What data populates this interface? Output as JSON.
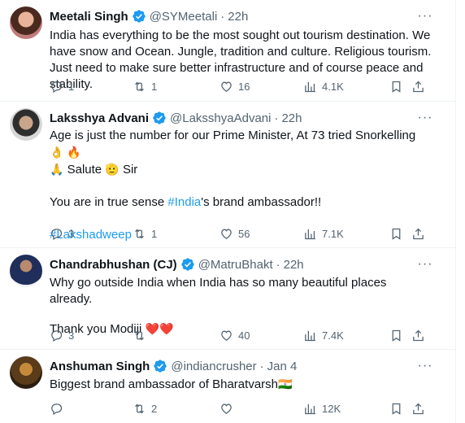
{
  "tweets": [
    {
      "name": "Meetali Singh",
      "handle": "@SYMeetali",
      "time": "22h",
      "text": "India has everything to be the most sought out tourism destination. We have snow and Ocean. Jungle, tradition and culture. Religious tourism. Just need to make sure better infrastructure and of course peace and stability.",
      "replies": "1",
      "retweets": "1",
      "likes": "16",
      "views": "4.1K"
    },
    {
      "name": "Laksshya Advani",
      "handle": "@LaksshyaAdvani",
      "time": "22h",
      "line1": "Age is just the number for our Prime Minister, At 73 tried Snorkelling",
      "line1_emoji": "👌 🔥",
      "line2_emoji_a": "🙏",
      "line2_text_a": "Salute",
      "line2_emoji_b": "🫡",
      "line2_text_b": "Sir",
      "para2_pre": "You are in true sense ",
      "para2_hashtag": "#India",
      "para2_post": "'s brand ambassador!!",
      "hashtag": "#Lakshadweep",
      "replies": "3",
      "retweets": "1",
      "likes": "56",
      "views": "7.1K"
    },
    {
      "name": "Chandrabhushan (CJ)",
      "handle": "@MatruBhakt",
      "time": "22h",
      "line1": "Why go outside India when India has so many beautiful places already.",
      "line2": "Thank you Modiji",
      "line2_emoji": "❤️❤️",
      "replies": "3",
      "retweets": "",
      "likes": "40",
      "views": "7.4K"
    },
    {
      "name": "Anshuman Singh",
      "handle": "@indiancrusher",
      "time": "Jan 4",
      "line1": "Biggest brand ambassador of Bharatvarsh",
      "line1_emoji": "🇮🇳",
      "replies": "",
      "retweets": "2",
      "likes": "",
      "views": "12K"
    }
  ],
  "dot": "·",
  "colors": {
    "verified": "#1d9bf0",
    "link": "#1d9bf0",
    "muted": "#536471"
  }
}
